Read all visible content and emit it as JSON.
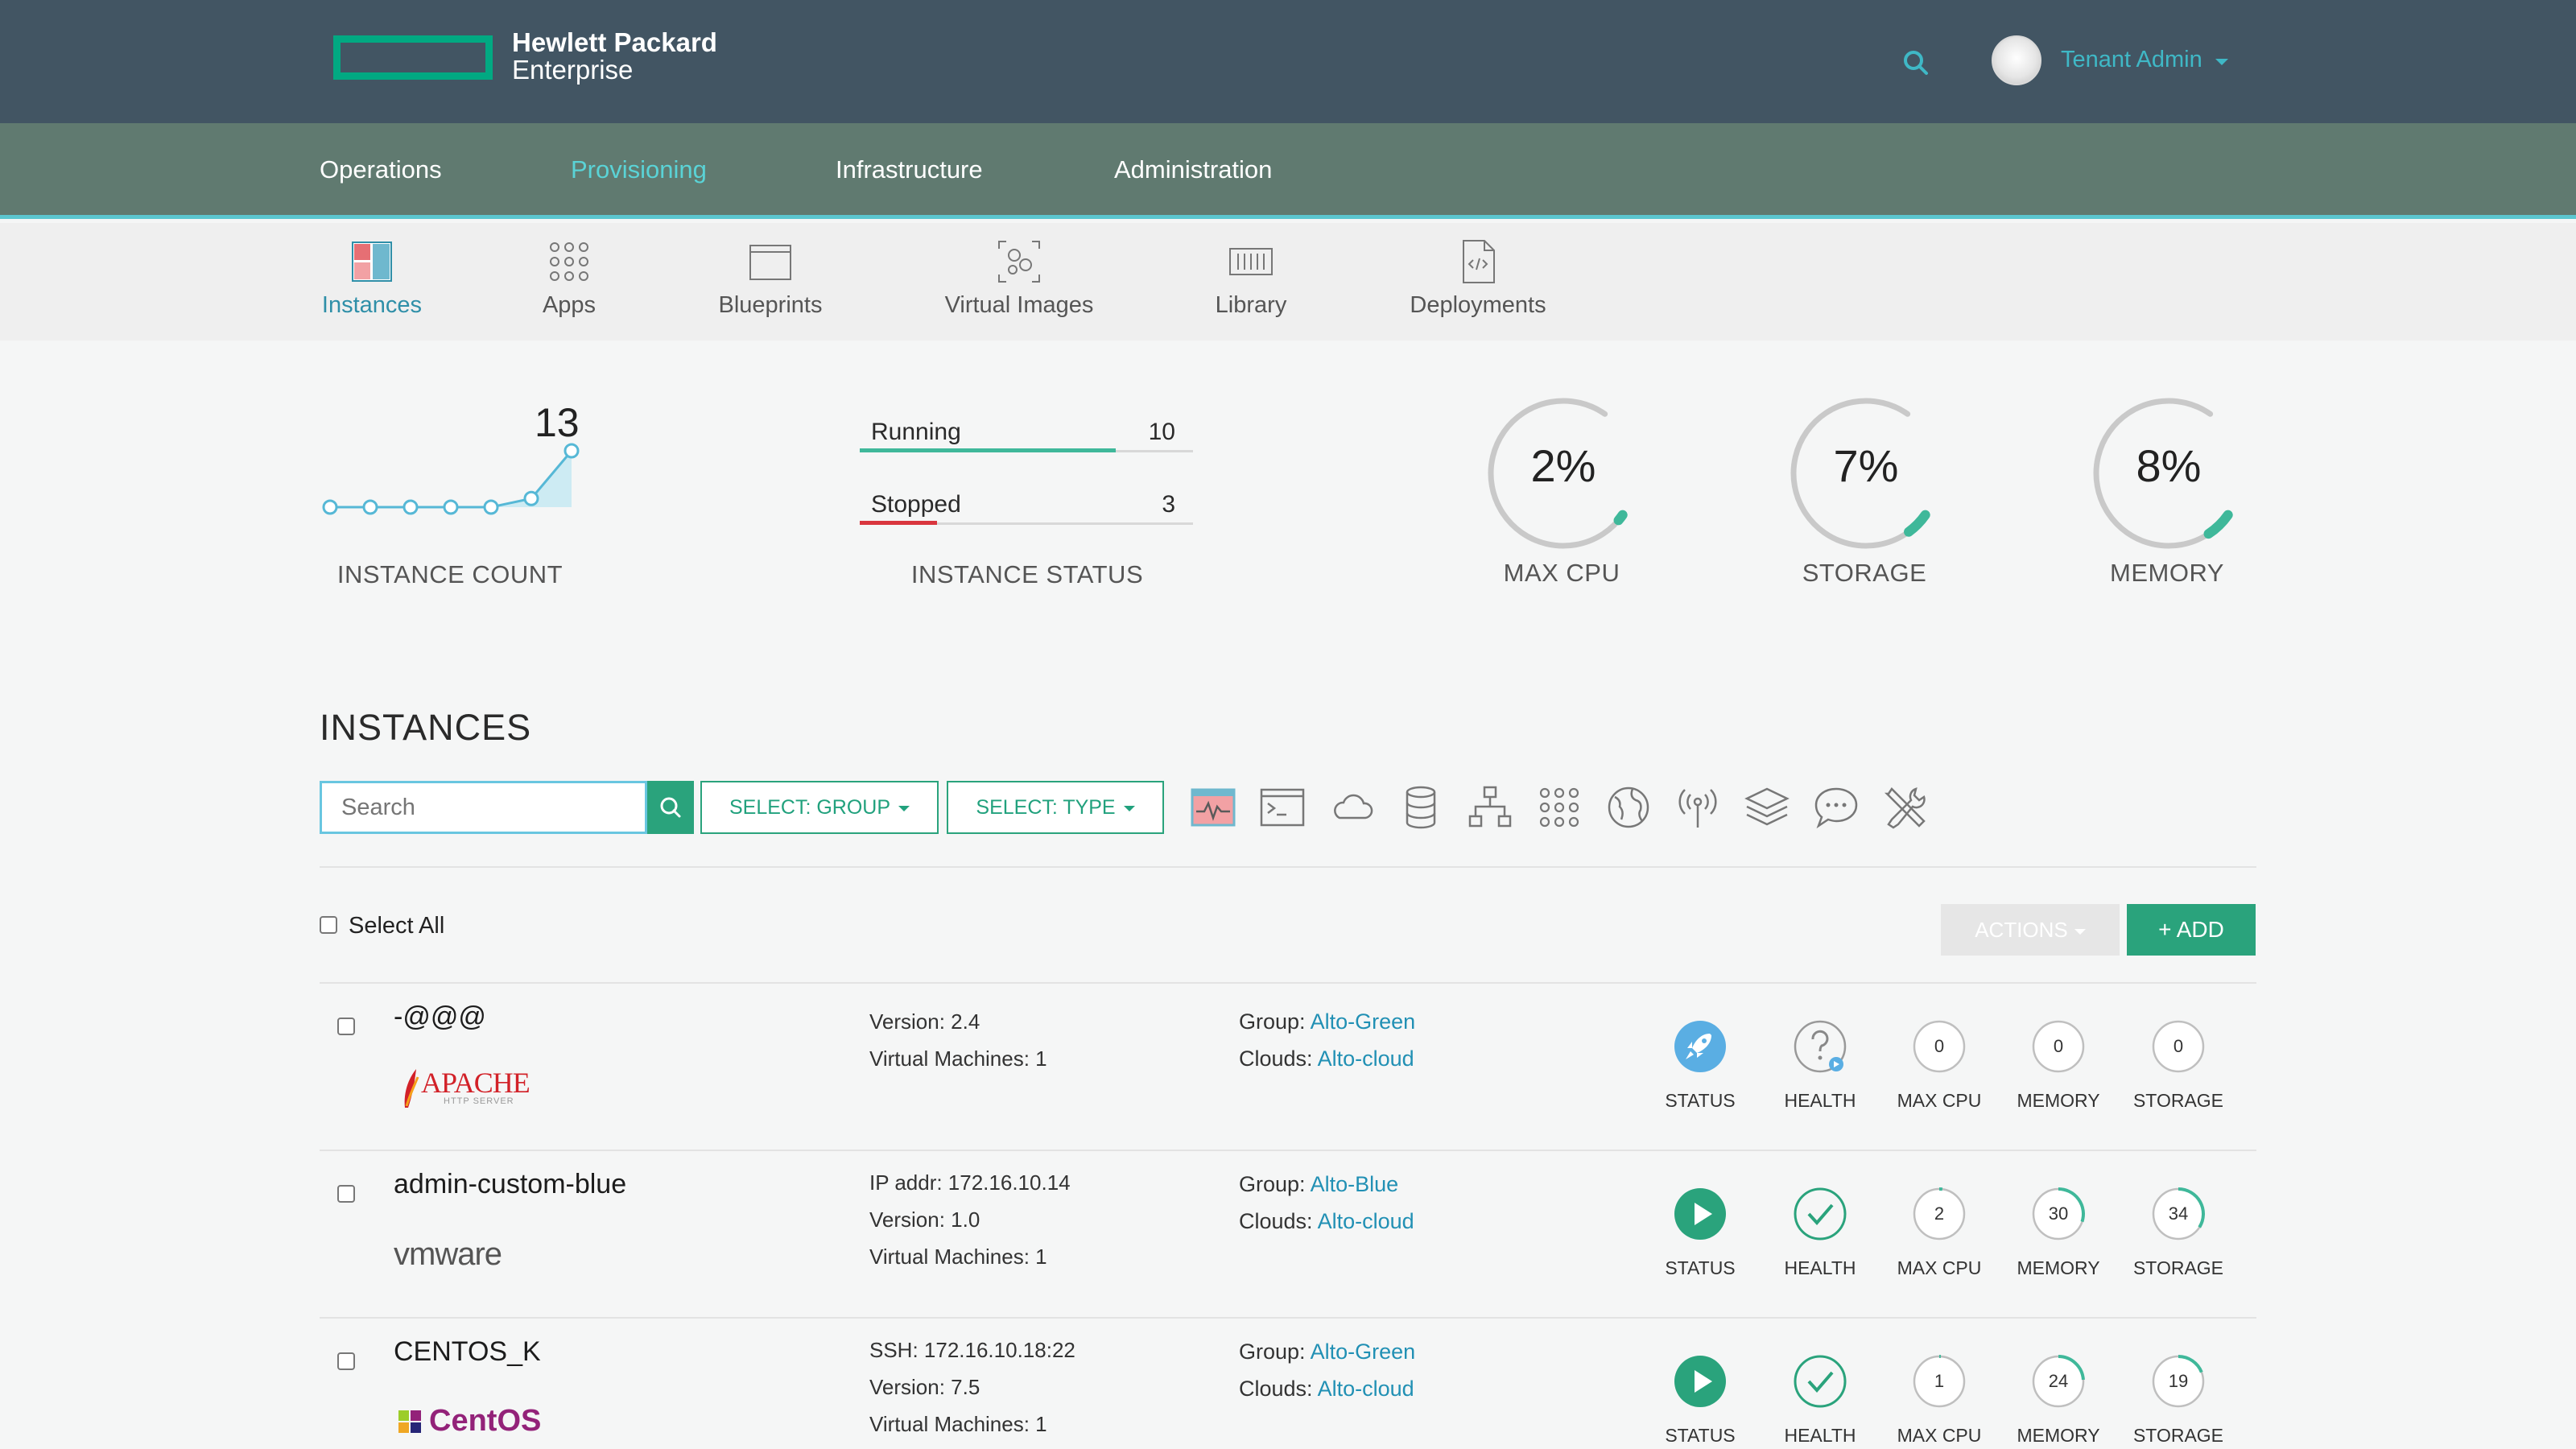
{
  "brand": {
    "line1": "Hewlett Packard",
    "line2": "Enterprise",
    "accent": "#01a982"
  },
  "header": {
    "user_name": "Tenant Admin",
    "bg": "#425563"
  },
  "main_nav": [
    {
      "label": "Operations",
      "active": false
    },
    {
      "label": "Provisioning",
      "active": true
    },
    {
      "label": "Infrastructure",
      "active": false
    },
    {
      "label": "Administration",
      "active": false
    }
  ],
  "sub_nav": [
    {
      "label": "Instances",
      "icon": "instances-icon",
      "active": true
    },
    {
      "label": "Apps",
      "icon": "apps-grid-icon",
      "active": false
    },
    {
      "label": "Blueprints",
      "icon": "blueprint-icon",
      "active": false
    },
    {
      "label": "Virtual Images",
      "icon": "virtual-image-icon",
      "active": false
    },
    {
      "label": "Library",
      "icon": "library-icon",
      "active": false
    },
    {
      "label": "Deployments",
      "icon": "deployment-file-icon",
      "active": false
    }
  ],
  "stats": {
    "instance_count": {
      "value": "13",
      "label": "INSTANCE COUNT",
      "series": [
        0,
        0,
        0,
        0,
        0,
        2,
        13
      ]
    },
    "instance_status": {
      "label": "INSTANCE STATUS",
      "rows": [
        {
          "name": "Running",
          "count": "10",
          "color": "#3fb89a"
        },
        {
          "name": "Stopped",
          "count": "3",
          "color": "#d9363e"
        }
      ]
    },
    "gauges": [
      {
        "pct": "2%",
        "value": 2,
        "label": "MAX CPU"
      },
      {
        "pct": "7%",
        "value": 7,
        "label": "STORAGE"
      },
      {
        "pct": "8%",
        "value": 8,
        "label": "MEMORY"
      }
    ]
  },
  "instances": {
    "title": "INSTANCES",
    "search_placeholder": "Search",
    "group_filter": "SELECT: GROUP",
    "type_filter": "SELECT: TYPE",
    "type_icons": [
      "monitor-chart-icon",
      "terminal-icon",
      "cloud-icon",
      "database-icon",
      "network-tree-icon",
      "apps-grid-icon",
      "globe-icon",
      "broadcast-icon",
      "layers-icon",
      "chat-icon",
      "tools-icon"
    ],
    "select_all": "Select All",
    "actions_label": "ACTIONS",
    "add_label": "+ ADD",
    "metric_labels": {
      "status": "STATUS",
      "health": "HEALTH",
      "cpu": "MAX CPU",
      "memory": "MEMORY",
      "storage": "STORAGE"
    },
    "rows": [
      {
        "name": "-@@@",
        "logo": "APACHE",
        "logo_sub": "HTTP SERVER",
        "info": [
          "Version: 2.4",
          "Virtual Machines: 1"
        ],
        "group_label": "Group: ",
        "group": "Alto-Green",
        "clouds_label": "Clouds: ",
        "clouds": "Alto-cloud",
        "status": "deploying",
        "health": "unknown",
        "cpu": "0",
        "memory": "0",
        "storage": "0"
      },
      {
        "name": "admin-custom-blue",
        "logo": "vmware",
        "info": [
          "IP addr: 172.16.10.14",
          "Version: 1.0",
          "Virtual Machines: 1"
        ],
        "group_label": "Group: ",
        "group": "Alto-Blue",
        "clouds_label": "Clouds: ",
        "clouds": "Alto-cloud",
        "status": "running",
        "health": "ok",
        "cpu": "2",
        "memory": "30",
        "storage": "34"
      },
      {
        "name": "CENTOS_K",
        "logo": "CentOS",
        "info": [
          "SSH: 172.16.10.18:22",
          "Version: 7.5",
          "Virtual Machines: 1"
        ],
        "group_label": "Group: ",
        "group": "Alto-Green",
        "clouds_label": "Clouds: ",
        "clouds": "Alto-cloud",
        "status": "running",
        "health": "ok",
        "cpu": "1",
        "memory": "24",
        "storage": "19"
      }
    ]
  }
}
